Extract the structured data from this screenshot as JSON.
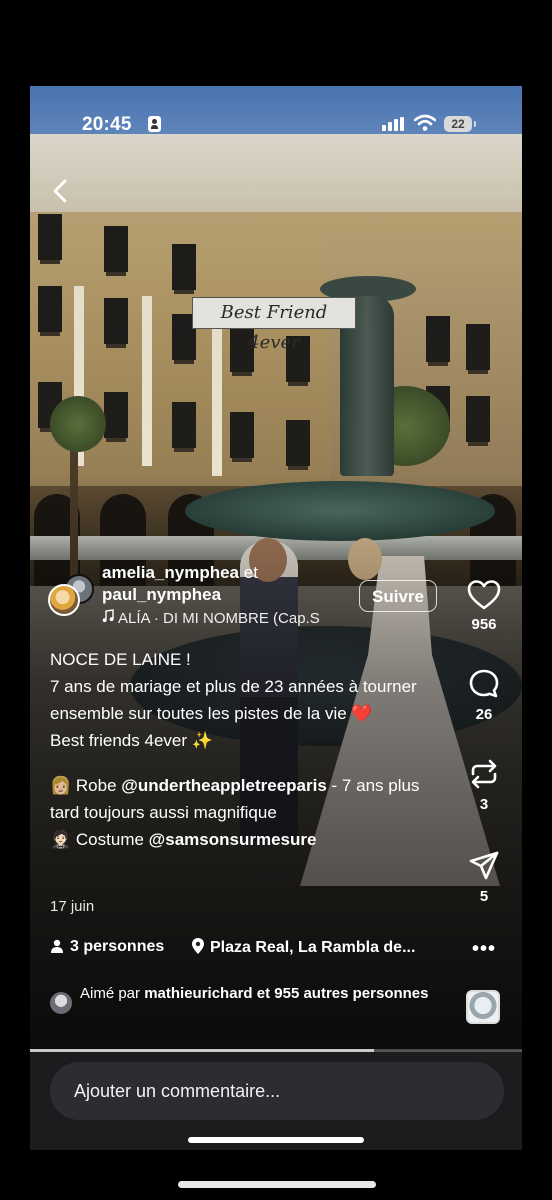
{
  "status_bar": {
    "time": "20:45",
    "battery": "22"
  },
  "sticker": "Best Friend 4ever",
  "post": {
    "author1": "amelia_nymphea",
    "connector": "et",
    "author2": "paul_nymphea",
    "music": "ALÍA · DI MI NOMBRE (Cap.S",
    "follow_label": "Suivre",
    "caption": {
      "line1": "NOCE DE LAINE !",
      "line2": "7 ans de mariage et plus de 23 années à tourner ensemble sur toutes les pistes de la vie ❤️",
      "line3": "Best friends 4ever ✨",
      "dress_emoji": "👩🏼",
      "dress_prefix": "Robe",
      "dress_mention": "@undertheappletreeparis",
      "dress_suffix": "- 7 ans plus tard toujours aussi magnifique",
      "suit_emoji": "🤵🏻",
      "suit_prefix": "Costume",
      "suit_mention": "@samsonsurmesure"
    },
    "date": "17 juin",
    "people": "3 personnes",
    "location": "Plaza Real, La Rambla de...",
    "liked_by_prefix": "Aimé par",
    "liked_by_user": "mathieurichard",
    "liked_by_suffix": "et 955 autres personnes"
  },
  "actions": {
    "likes": "956",
    "comments": "26",
    "reposts": "3",
    "shares": "5"
  },
  "progress": 0.7,
  "comment_placeholder": "Ajouter un commentaire...",
  "icons": [
    "back-arrow-icon",
    "music-note-icon",
    "heart-icon",
    "comment-icon",
    "repost-icon",
    "send-icon",
    "person-icon",
    "location-pin-icon",
    "more-icon"
  ]
}
